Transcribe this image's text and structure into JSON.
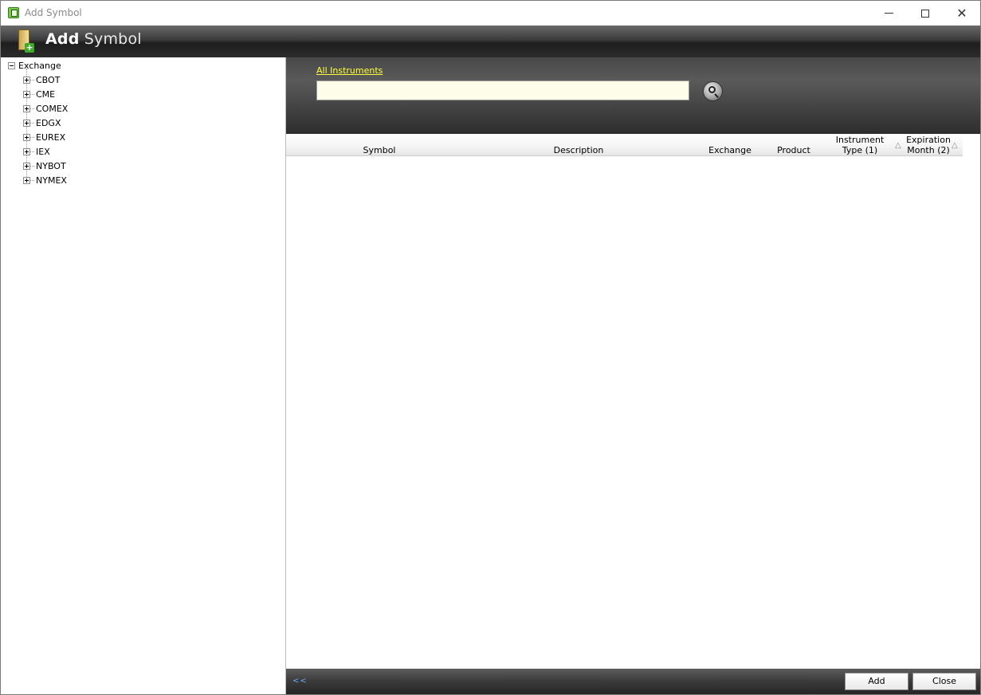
{
  "window": {
    "title": "Add Symbol",
    "controls": {
      "minimize": "—",
      "maximize": "",
      "close": "✕"
    }
  },
  "header": {
    "title_bold": "Add",
    "title_light": "Symbol"
  },
  "tree": {
    "root": "Exchange",
    "items": [
      "CBOT",
      "CME",
      "COMEX",
      "EDGX",
      "EUREX",
      "IEX",
      "NYBOT",
      "NYMEX"
    ]
  },
  "search": {
    "filter_link": "All Instruments",
    "value": "",
    "button_icon": "magnifier-icon"
  },
  "grid": {
    "columns": [
      {
        "label": "Symbol"
      },
      {
        "label": "Description"
      },
      {
        "label": "Exchange"
      },
      {
        "label": "Product"
      },
      {
        "line1": "Instrument",
        "line2": "Type (1)"
      },
      {
        "line1": "Expiration",
        "line2": "Month (2)"
      }
    ],
    "sort_glyph": "△",
    "rows": []
  },
  "footer": {
    "back_label": "<<",
    "add_label": "Add",
    "close_label": "Close"
  },
  "colors": {
    "link": "#ffff3a",
    "search_bg": "#fefde9",
    "back_link": "#6aa8ff"
  }
}
